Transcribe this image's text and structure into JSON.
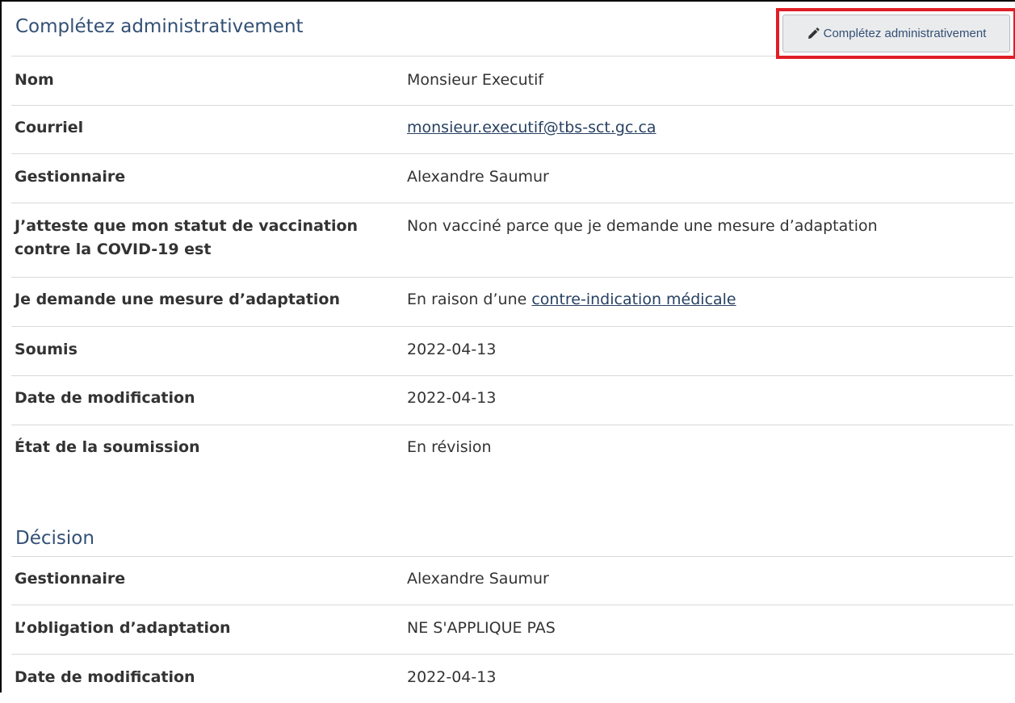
{
  "section1": {
    "title": "Complétez administrativement",
    "button_label": "Complétez administrativement",
    "button_icon": "pencil-icon",
    "rows": [
      {
        "label": "Nom",
        "value": "Monsieur Executif"
      },
      {
        "label": "Courriel",
        "value": "monsieur.executif@tbs-sct.gc.ca"
      },
      {
        "label": "Gestionnaire",
        "value": "Alexandre Saumur"
      },
      {
        "label": "J’atteste que mon statut de vaccination contre la COVID-19 est",
        "value": "Non vacciné parce que je demande une mesure d’adaptation"
      },
      {
        "label": "Je demande une mesure d’adaptation",
        "value_prefix": "En raison d’une ",
        "value_link": "contre-indication médicale"
      },
      {
        "label": "Soumis",
        "value": "2022-04-13"
      },
      {
        "label": "Date de modification",
        "value": "2022-04-13"
      },
      {
        "label": "État de la soumission",
        "value": "En révision"
      }
    ]
  },
  "section2": {
    "title": "Décision",
    "rows": [
      {
        "label": "Gestionnaire",
        "value": "Alexandre Saumur"
      },
      {
        "label": "L’obligation d’adaptation",
        "value": "NE S'APPLIQUE PAS"
      },
      {
        "label": "Date de modification",
        "value": "2022-04-13"
      }
    ]
  },
  "colors": {
    "heading": "#335075",
    "link": "#284162",
    "highlight": "#e01d25",
    "divider": "#d9d9d9"
  }
}
